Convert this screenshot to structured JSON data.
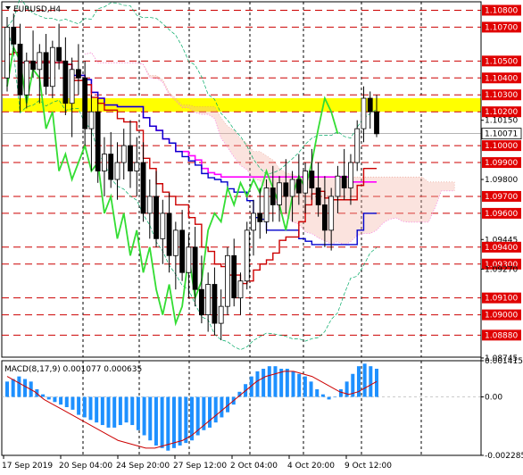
{
  "window": {
    "title": "EURUSD,H4",
    "title_icon": "chart-dropdown-triangle"
  },
  "chart_data": [
    {
      "type": "candlestick",
      "title": "EURUSD,H4",
      "ylim": [
        1.0875,
        1.1085
      ],
      "y_tick_labels": [
        "1.10800",
        "1.10700",
        "1.10500",
        "1.10400",
        "1.10300",
        "1.10200",
        "1.10150",
        "1.10000",
        "1.09900",
        "1.09800",
        "1.09700",
        "1.09600",
        "1.09445",
        "1.09400",
        "1.09300",
        "1.09270",
        "1.09100",
        "1.09000",
        "1.08880",
        "1.08745"
      ],
      "highlight_labels": [
        "1.10800",
        "1.10700",
        "1.10500",
        "1.10400",
        "1.10300",
        "1.10200",
        "1.10000",
        "1.09900",
        "1.09700",
        "1.09600",
        "1.09400",
        "1.09300",
        "1.09100",
        "1.09000",
        "1.08880"
      ],
      "current_price": "1.10071",
      "level_lines": [
        1.108,
        1.107,
        1.105,
        1.104,
        1.103,
        1.102,
        1.1,
        1.099,
        1.097,
        1.096,
        1.094,
        1.093,
        1.091,
        1.09,
        1.0888
      ],
      "yellow_zone": [
        1.102,
        1.1028
      ],
      "x_labels": [
        "17 Sep 2019",
        "20 Sep 04:00",
        "24 Sep 20:00",
        "27 Sep 12:00",
        "2 Oct 04:00",
        "4 Oct 20:00",
        "9 Oct 12:00"
      ],
      "ohlc": [
        [
          1.104,
          1.1076,
          1.1032,
          1.107
        ],
        [
          1.107,
          1.1078,
          1.1055,
          1.106
        ],
        [
          1.106,
          1.1072,
          1.102,
          1.103
        ],
        [
          1.103,
          1.1055,
          1.1022,
          1.105
        ],
        [
          1.105,
          1.1068,
          1.104,
          1.1045
        ],
        [
          1.1045,
          1.106,
          1.1025,
          1.1055
        ],
        [
          1.1055,
          1.1066,
          1.103,
          1.1035
        ],
        [
          1.1035,
          1.1062,
          1.1028,
          1.1058
        ],
        [
          1.1058,
          1.1072,
          1.1045,
          1.105
        ],
        [
          1.105,
          1.1064,
          1.1018,
          1.1025
        ],
        [
          1.1025,
          1.1052,
          1.1005,
          1.1045
        ],
        [
          1.1045,
          1.106,
          1.103,
          1.104
        ],
        [
          1.104,
          1.105,
          1.1,
          1.101
        ],
        [
          1.101,
          1.103,
          1.0985,
          1.102
        ],
        [
          1.102,
          1.1028,
          1.0978,
          1.0985
        ],
        [
          1.0985,
          1.1005,
          1.097,
          1.0995
        ],
        [
          1.0995,
          1.1008,
          1.0975,
          1.098
        ],
        [
          1.098,
          1.1002,
          1.0968,
          1.099
        ],
        [
          1.099,
          1.101,
          1.098,
          1.1
        ],
        [
          1.1,
          1.1015,
          1.0975,
          1.0985
        ],
        [
          1.0985,
          1.1005,
          1.097,
          1.099
        ],
        [
          1.099,
          1.1002,
          1.0955,
          1.096
        ],
        [
          1.096,
          1.098,
          1.0945,
          1.097
        ],
        [
          1.097,
          1.0985,
          1.094,
          1.0945
        ],
        [
          1.0945,
          1.0968,
          1.093,
          1.096
        ],
        [
          1.096,
          1.0972,
          1.0925,
          1.0935
        ],
        [
          1.0935,
          1.0955,
          1.0915,
          1.095
        ],
        [
          1.095,
          1.0962,
          1.092,
          1.0925
        ],
        [
          1.0925,
          1.0948,
          1.091,
          1.094
        ],
        [
          1.094,
          1.0952,
          1.0905,
          1.0915
        ],
        [
          1.0915,
          1.0935,
          1.0895,
          1.09
        ],
        [
          1.09,
          1.0925,
          1.089,
          1.0918
        ],
        [
          1.0918,
          1.0928,
          1.0888,
          1.0895
        ],
        [
          1.0895,
          1.0915,
          1.0885,
          1.0905
        ],
        [
          1.0905,
          1.094,
          1.09,
          1.0935
        ],
        [
          1.0935,
          1.0945,
          1.0905,
          1.091
        ],
        [
          1.091,
          1.0925,
          1.09,
          1.092
        ],
        [
          1.092,
          1.0955,
          1.0915,
          1.095
        ],
        [
          1.095,
          1.0968,
          1.0935,
          1.096
        ],
        [
          1.096,
          1.0975,
          1.0945,
          1.0955
        ],
        [
          1.0955,
          1.098,
          1.0948,
          1.0975
        ],
        [
          1.0975,
          1.0988,
          1.0955,
          1.0965
        ],
        [
          1.0965,
          1.0982,
          1.0955,
          1.0978
        ],
        [
          1.0978,
          1.0992,
          1.096,
          1.097
        ],
        [
          1.097,
          1.0985,
          1.0955,
          1.098
        ],
        [
          1.098,
          1.0995,
          1.0965,
          1.0972
        ],
        [
          1.0972,
          1.099,
          1.096,
          1.0985
        ],
        [
          1.0985,
          1.0998,
          1.0968,
          1.0975
        ],
        [
          1.0975,
          1.099,
          1.0958,
          1.0965
        ],
        [
          1.0965,
          1.0982,
          1.094,
          1.095
        ],
        [
          1.095,
          1.0975,
          1.0938,
          1.097
        ],
        [
          1.097,
          1.0988,
          1.096,
          1.0982
        ],
        [
          1.0982,
          1.0998,
          1.0968,
          1.0975
        ],
        [
          1.0975,
          1.0995,
          1.0965,
          1.099
        ],
        [
          1.099,
          1.1015,
          1.0985,
          1.101
        ],
        [
          1.101,
          1.1035,
          1.1002,
          1.1028
        ],
        [
          1.1028,
          1.1032,
          1.101,
          1.102
        ],
        [
          1.102,
          1.103,
          1.1005,
          1.1007
        ]
      ],
      "series": [
        {
          "name": "",
          "color": "#ff00ff"
        },
        {
          "name": "",
          "color": "#0000cc"
        },
        {
          "name": "",
          "color": "#cc0000"
        },
        {
          "name": "",
          "color": "#33dd33"
        },
        {
          "name": "",
          "color": "#00aa66"
        }
      ]
    },
    {
      "type": "bar",
      "title": "MACD(8,17,9) 0.001077 0.000635",
      "y_tick_labels": [
        "0.001415",
        "0.00",
        "-0.002285"
      ],
      "ylim": [
        -0.002285,
        0.001415
      ],
      "histogram": [
        0.0006,
        0.0007,
        0.0008,
        0.0007,
        0.0006,
        0.0003,
        0.0001,
        -0.0001,
        -0.0002,
        -0.0003,
        -0.0004,
        -0.0005,
        -0.0007,
        -0.0008,
        -0.0009,
        -0.001,
        -0.0011,
        -0.0012,
        -0.0012,
        -0.0011,
        -0.001,
        -0.0011,
        -0.0013,
        -0.0015,
        -0.0017,
        -0.0019,
        -0.002,
        -0.0021,
        -0.002,
        -0.0019,
        -0.0018,
        -0.0017,
        -0.0015,
        -0.0013,
        -0.0012,
        -0.001,
        -0.0008,
        -0.0006,
        -0.0003,
        0.0002,
        0.0005,
        0.0008,
        0.001,
        0.0011,
        0.0012,
        0.0012,
        0.0011,
        0.0011,
        0.001,
        0.0009,
        0.0008,
        0.0006,
        0.0003,
        0.0001,
        -0.0001,
        0.0,
        0.0003,
        0.0006,
        0.0009,
        0.0012,
        0.0013,
        0.0012,
        0.0011
      ],
      "signal": [
        0.0008,
        0.0006,
        0.0004,
        0.0002,
        -0.0001,
        -0.0003,
        -0.0005,
        -0.0007,
        -0.0009,
        -0.0011,
        -0.0013,
        -0.0015,
        -0.0017,
        -0.0018,
        -0.0019,
        -0.002,
        -0.002,
        -0.0019,
        -0.0018,
        -0.0017,
        -0.0015,
        -0.0012,
        -0.0009,
        -0.0006,
        -0.0003,
        0.0,
        0.0003,
        0.0006,
        0.0008,
        0.0009,
        0.001,
        0.001,
        0.0009,
        0.0008,
        0.0006,
        0.0004,
        0.0002,
        0.0001,
        0.0002,
        0.0004,
        0.0006
      ],
      "signal_color": "#cc0000",
      "bar_color": "#1e90ff"
    }
  ]
}
